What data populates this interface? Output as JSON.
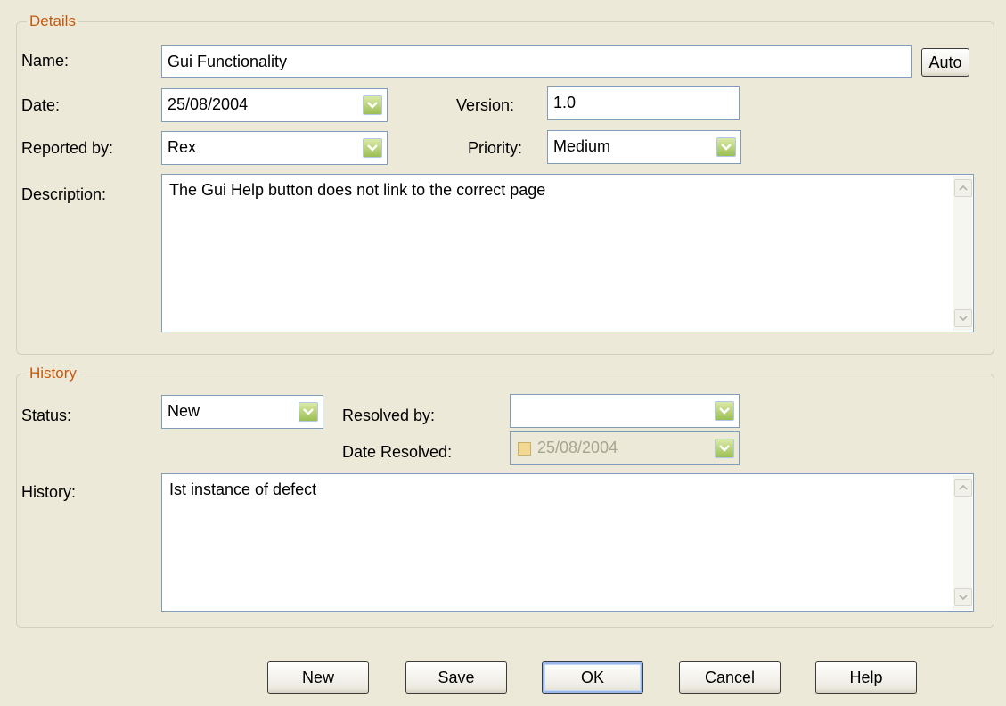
{
  "details": {
    "legend": "Details",
    "name_label": "Name:",
    "name_value": "Gui Functionality",
    "auto_label": "Auto",
    "date_label": "Date:",
    "date_value": "25/08/2004",
    "version_label": "Version:",
    "version_value": "1.0",
    "reported_by_label": "Reported by:",
    "reported_by_value": "Rex",
    "priority_label": "Priority:",
    "priority_value": "Medium",
    "description_label": "Description:",
    "description_value": "The Gui Help button does not link to the correct page"
  },
  "history": {
    "legend": "History",
    "status_label": "Status:",
    "status_value": "New",
    "resolved_by_label": "Resolved by:",
    "resolved_by_value": "",
    "date_resolved_label": "Date Resolved:",
    "date_resolved_value": "25/08/2004",
    "history_label": "History:",
    "history_value": "Ist instance of defect"
  },
  "buttons": {
    "new": "New",
    "save": "Save",
    "ok": "OK",
    "cancel": "Cancel",
    "help": "Help"
  },
  "icons": {
    "dropdown": "chevron-down-icon",
    "scroll_up": "scroll-up-icon",
    "scroll_down": "scroll-down-icon"
  },
  "colors": {
    "window_bg": "#ece9d8",
    "legend_text": "#c45a10",
    "field_border": "#7f9db9",
    "dropdown_button": "#9bbf53"
  }
}
